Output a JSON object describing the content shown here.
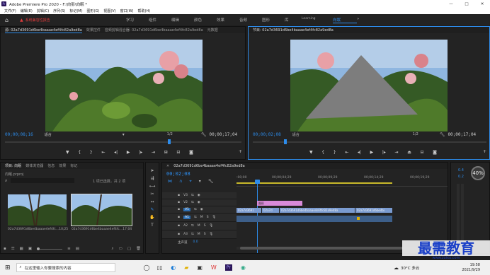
{
  "window": {
    "title": "Adobe Premiere Pro 2020 - F:\\向影\\向眠 *",
    "minimize": "—",
    "maximize": "□",
    "close": "✕"
  },
  "menu": [
    "文件(F)",
    "编辑(E)",
    "剪辑(C)",
    "序列(S)",
    "标记(M)",
    "图形(G)",
    "视图(V)",
    "窗口(W)",
    "帮助(H)"
  ],
  "workspaces": [
    "学习",
    "组件",
    "编辑",
    "颜色",
    "效果",
    "音频",
    "图形",
    "库",
    "Learning",
    "向眠",
    "»"
  ],
  "active_workspace_index": 9,
  "alert": {
    "text": "系统兼容性报告"
  },
  "source_monitor": {
    "tabs": [
      "源: 02a7d3691d6be4baaae4ef4fc82a9ed8a",
      "效果控件",
      "音频剪辑混合器: 02a7d3691d6be4baaae4ef4fc82a9ed8a",
      "元数据"
    ],
    "timecode_in": "00;00;08;16",
    "fit": "适合",
    "ratio": "1/2",
    "timecode_out": "00;00;17;04"
  },
  "program_monitor": {
    "tabs": [
      "节目: 02a7d3691d6be4baaae4ef4fc82a9ed8a"
    ],
    "timecode_in": "00;00;02;08",
    "fit": "适合",
    "ratio": "1/2",
    "timecode_out": "00;00;17;04"
  },
  "project": {
    "tabs": [
      "项目: 向眠",
      "媒体浏览器",
      "信息",
      "效果",
      "标记"
    ],
    "name": "向眠.prproj",
    "selection": "1 项已选择，共 2 项",
    "items": [
      {
        "name": "02a7d3691d6be4baaae4ef4fc...",
        "duration": "10;25"
      },
      {
        "name": "02a7d3691d6be4baaae4ef4fc...",
        "duration": "17;04"
      }
    ]
  },
  "timeline": {
    "tab": "02a7d3691d6be4baaae4ef4fc82a9ed8a",
    "timecode": "00;02;08",
    "ruler": [
      ":00;00",
      "00;00;04;29",
      "00;00;09;29",
      "00;00;14;29",
      "00;00;19;29"
    ],
    "tracks": [
      "V3",
      "V2",
      "V1",
      "A1",
      "A2",
      "A3"
    ],
    "master": "主声道",
    "master_value": "0.0",
    "clips": {
      "graphic": "图形",
      "v1": [
        "02a7d3691",
        "02a7d",
        "02a7d3691d6be4baaae4ef4fc82a9ed8a",
        "02a7d3691d6be4bi"
      ]
    }
  },
  "meter": {
    "labels": [
      "0.4",
      "0.2"
    ],
    "percent": "40%"
  },
  "watermark": {
    "text": "最需教育",
    "url": "www.zuixu.com"
  },
  "taskbar": {
    "search": "在这里输入你要搜索的内容",
    "weather": "30°C 多云",
    "time": "19:58",
    "date": "2021/9/29"
  },
  "colors": {
    "accent": "#2d8ceb",
    "timeline_clip": "#7a9bd0",
    "graphic_clip": "#d98ad9",
    "playhead": "#2d8ceb"
  }
}
